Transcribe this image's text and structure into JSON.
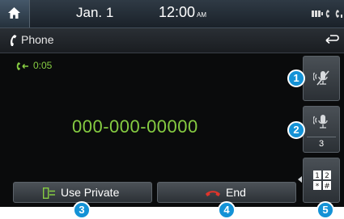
{
  "status_bar": {
    "date": "Jan.  1",
    "time": "12:00",
    "ampm": "AM"
  },
  "title_bar": {
    "title": "Phone"
  },
  "call": {
    "duration": "0:05",
    "number": "000-000-00000"
  },
  "side_buttons": {
    "volume_level": "3"
  },
  "bottom_buttons": {
    "private_label": "Use Private",
    "end_label": "End"
  },
  "callouts": [
    "1",
    "2",
    "3",
    "4",
    "5"
  ],
  "colors": {
    "accent_green": "#86cc42",
    "end_red": "#e0342b",
    "callout_blue": "#1492d6"
  }
}
